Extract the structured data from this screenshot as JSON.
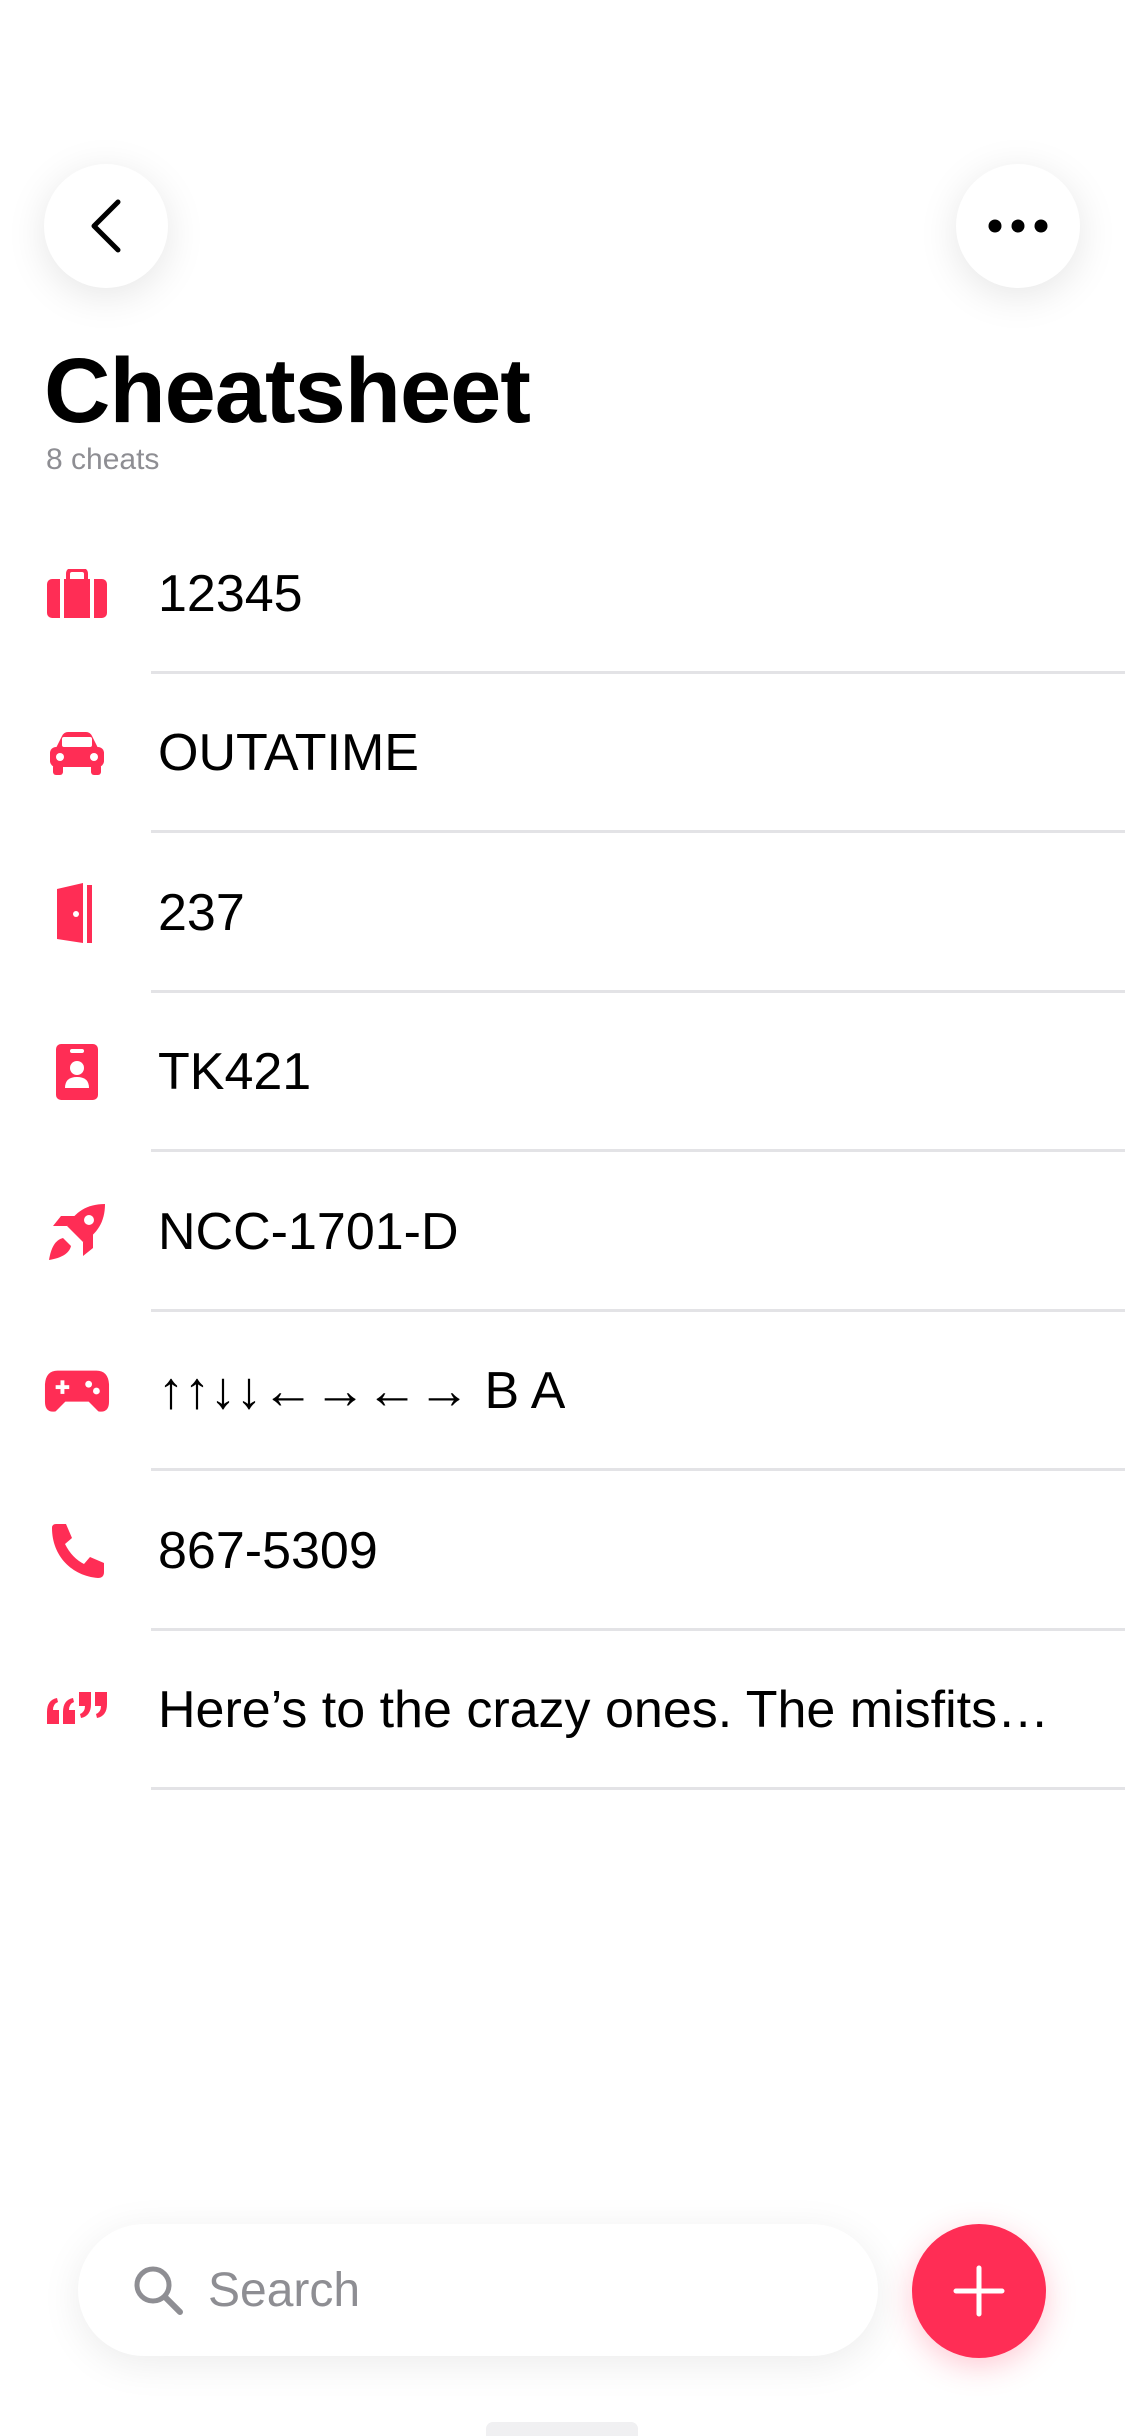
{
  "header": {
    "title": "Cheatsheet",
    "subtitle": "8 cheats"
  },
  "icons": {
    "back": "chevron-left-icon",
    "more": "ellipsis-icon",
    "search": "search-icon",
    "add": "plus-icon"
  },
  "colors": {
    "accent": "#ff2d55",
    "text": "#000000",
    "secondary_text": "#8e8e93",
    "divider": "#e3e3e6"
  },
  "cheats": [
    {
      "icon": "briefcase-icon",
      "label": "12345"
    },
    {
      "icon": "car-icon",
      "label": "OUTATIME"
    },
    {
      "icon": "door-icon",
      "label": "237"
    },
    {
      "icon": "id-badge-icon",
      "label": "TK421"
    },
    {
      "icon": "rocket-icon",
      "label": "NCC-1701-D"
    },
    {
      "icon": "gamepad-icon",
      "label": "↑↑↓↓←→←→ B A"
    },
    {
      "icon": "phone-icon",
      "label": "867-5309"
    },
    {
      "icon": "quote-icon",
      "label": "Here’s to the crazy ones. The misfits…"
    }
  ],
  "search": {
    "placeholder": "Search",
    "value": ""
  }
}
